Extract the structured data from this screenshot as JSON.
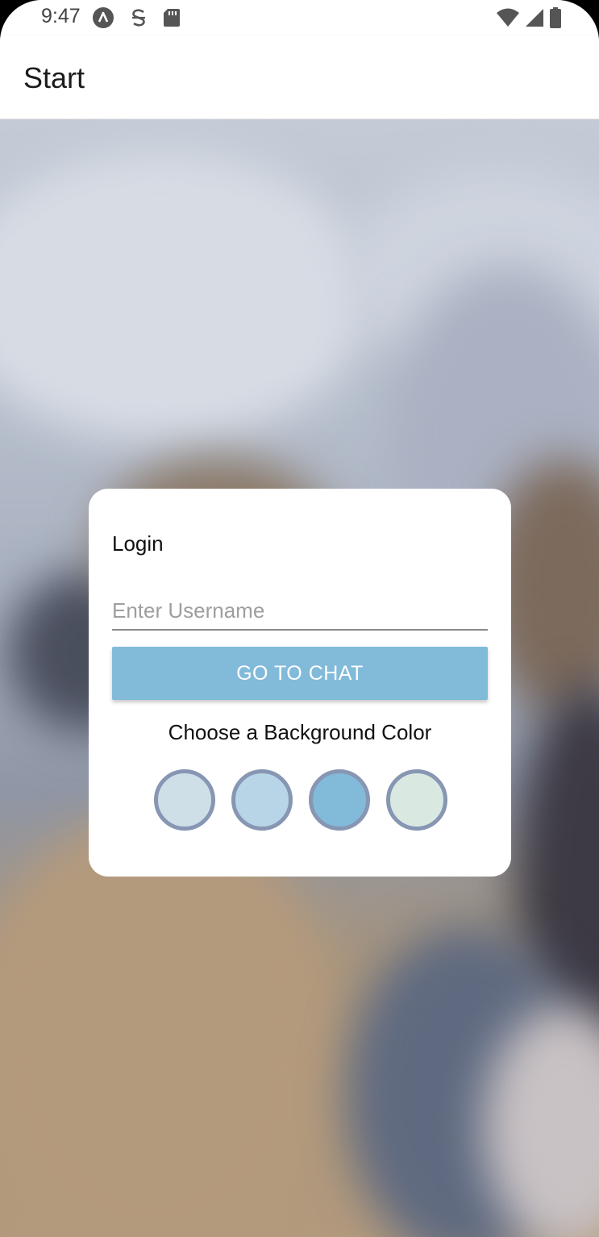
{
  "status_bar": {
    "time": "9:47",
    "left_icons": [
      "app-notification-icon",
      "settings-s-icon",
      "sd-card-icon"
    ],
    "right_icons": [
      "wifi-icon",
      "cellular-signal-icon",
      "battery-icon"
    ]
  },
  "app_bar": {
    "title": "Start"
  },
  "login_card": {
    "title": "Login",
    "username": {
      "value": "",
      "placeholder": "Enter Username"
    },
    "button_label": "GO TO CHAT",
    "button_color": "#82bad9",
    "color_heading": "Choose a Background Color",
    "color_options": [
      {
        "color": "#cfdfe8"
      },
      {
        "color": "#b8d5e8"
      },
      {
        "color": "#82bad9"
      },
      {
        "color": "#d9e8e1"
      }
    ],
    "swatch_border_color": "#8796b3"
  }
}
